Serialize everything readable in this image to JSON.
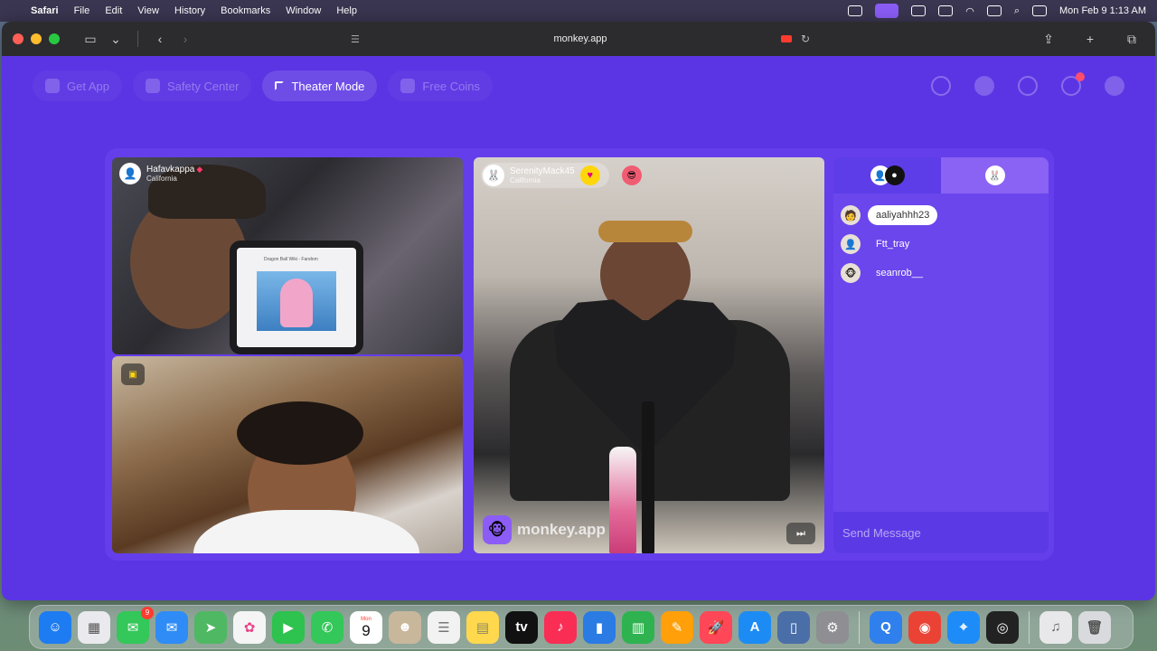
{
  "menubar": {
    "app": "Safari",
    "items": [
      "File",
      "Edit",
      "View",
      "History",
      "Bookmarks",
      "Window",
      "Help"
    ],
    "clock": "Mon Feb 9  1:13 AM"
  },
  "browser": {
    "url": "monkey.app"
  },
  "site": {
    "nav": [
      {
        "label": "Get App"
      },
      {
        "label": "Safety Center"
      },
      {
        "label": "Theater Mode"
      },
      {
        "label": "Free Coins"
      }
    ],
    "notification_count": "1"
  },
  "tiles": {
    "a": {
      "username": "Hafavkappa",
      "location": "California",
      "phone_caption": "Dragon Ball Wiki - Fandom"
    },
    "c": {
      "username": "SerenityMack45",
      "location": "California",
      "watermark": "monkey.app"
    }
  },
  "chat": {
    "users": [
      {
        "name": "aaliyahhh23",
        "avatar": "🧑"
      },
      {
        "name": "Ftt_tray",
        "avatar": "👤"
      },
      {
        "name": "seanrob__",
        "avatar": "🐵"
      }
    ],
    "placeholder": "Send Message"
  },
  "dock": {
    "messages_badge": "9",
    "calendar_month": "Mon",
    "calendar_day": "9",
    "apps": [
      {
        "name": "Finder",
        "color": "#1e7cf2"
      },
      {
        "name": "Launchpad",
        "color": "#e9e9ee"
      },
      {
        "name": "Messages",
        "color": "#34c759"
      },
      {
        "name": "Mail",
        "color": "#2f8cf6"
      },
      {
        "name": "Maps",
        "color": "#4fb863"
      },
      {
        "name": "Photos",
        "color": "#f5f5f5"
      },
      {
        "name": "FaceTime",
        "color": "#2ec24e"
      },
      {
        "name": "Phone",
        "color": "#34c759"
      },
      {
        "name": "Calendar",
        "color": "#ffffff"
      },
      {
        "name": "Contacts",
        "color": "#c9b79c"
      },
      {
        "name": "Reminders",
        "color": "#f2f2f2"
      },
      {
        "name": "Notes",
        "color": "#ffd84d"
      },
      {
        "name": "TV",
        "color": "#111111"
      },
      {
        "name": "Music",
        "color": "#fa2d55"
      },
      {
        "name": "Keynote",
        "color": "#2a7be4"
      },
      {
        "name": "Numbers",
        "color": "#2fb350"
      },
      {
        "name": "Pages",
        "color": "#ff9f0a"
      },
      {
        "name": "Rocket",
        "color": "#ff4757"
      },
      {
        "name": "App Store",
        "color": "#1c8cf4"
      },
      {
        "name": "Preview",
        "color": "#4a6ea8"
      },
      {
        "name": "System Settings",
        "color": "#8e8e93"
      },
      {
        "name": "QuickTime",
        "color": "#2f80ed"
      },
      {
        "name": "Chrome",
        "color": "#ea4335"
      },
      {
        "name": "Safari",
        "color": "#1d8cf8"
      },
      {
        "name": "OBS",
        "color": "#222222"
      },
      {
        "name": "Music Folder",
        "color": "#e8e8ea"
      },
      {
        "name": "Trash",
        "color": "#d8dadd"
      }
    ]
  }
}
